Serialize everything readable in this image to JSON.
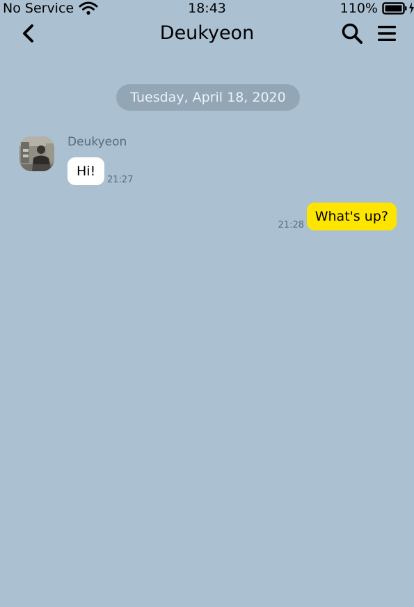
{
  "status_bar": {
    "carrier": "No Service",
    "time": "18:43",
    "battery": "110%"
  },
  "nav": {
    "title": "Deukyeon",
    "icons": [
      "back-icon",
      "search-icon",
      "menu-icon"
    ]
  },
  "chat": {
    "date_divider": "Tuesday, April 18, 2020",
    "messages": [
      {
        "direction": "incoming",
        "sender": "Deukyeon",
        "text": "Hi!",
        "time": "21:27"
      },
      {
        "direction": "outgoing",
        "text": "What's up?",
        "time": "21:28"
      }
    ]
  },
  "colors": {
    "background": "#abc0d1",
    "date_pill": "#93a6b6",
    "incoming_bubble": "#ffffff",
    "outgoing_bubble": "#fee500"
  }
}
